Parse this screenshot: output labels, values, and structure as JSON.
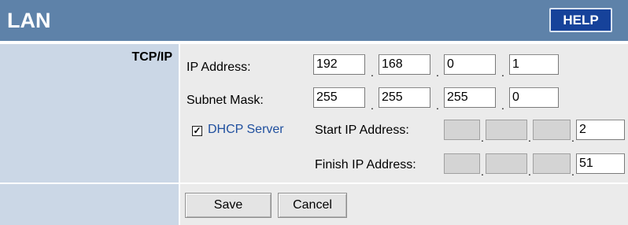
{
  "header": {
    "title": "LAN",
    "help_label": "HELP"
  },
  "section": {
    "label": "TCP/IP"
  },
  "ip_address": {
    "label": "IP Address:",
    "octets": [
      "192",
      "168",
      "0",
      "1"
    ]
  },
  "subnet_mask": {
    "label": "Subnet Mask:",
    "octets": [
      "255",
      "255",
      "255",
      "0"
    ]
  },
  "dhcp": {
    "checked": true,
    "check_glyph": "✓",
    "label": "DHCP Server",
    "start_label": "Start IP Address:",
    "start_octets": [
      "",
      "",
      "",
      "2"
    ],
    "finish_label": "Finish IP Address:",
    "finish_octets": [
      "",
      "",
      "",
      "51"
    ]
  },
  "buttons": {
    "save": "Save",
    "cancel": "Cancel"
  },
  "colors": {
    "header_bg": "#5e82a9",
    "help_bg": "#16429a",
    "label_cell_bg": "#cbd7e6",
    "content_cell_bg": "#ebebeb",
    "dhcp_link": "#1f4f9e"
  }
}
